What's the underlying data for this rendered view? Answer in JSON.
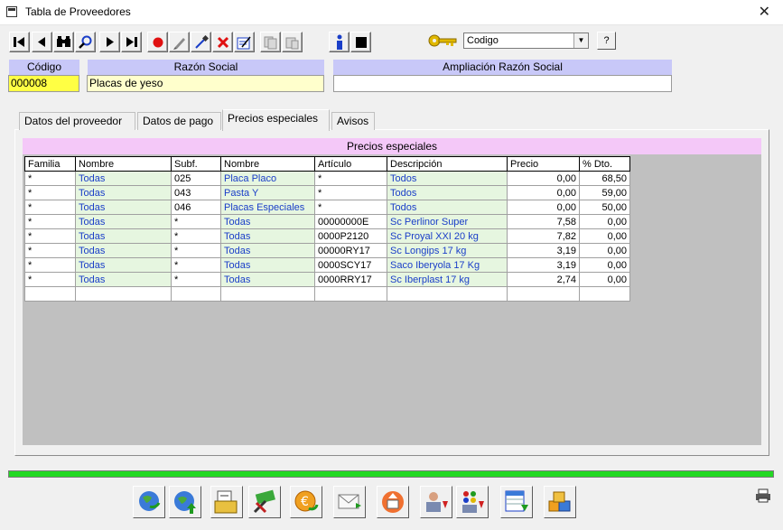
{
  "window": {
    "title": "Tabla de Proveedores",
    "close_glyph": "✕"
  },
  "toolbar": {
    "search_field": {
      "value": "Codigo"
    },
    "help_label": "?"
  },
  "header_fields": {
    "codigo": {
      "label": "Código",
      "value": "000008",
      "bg": "#ffff44"
    },
    "razon_social": {
      "label": "Razón Social",
      "value": "Placas de yeso",
      "bg": "#ffffcc"
    },
    "ampliacion": {
      "label": "Ampliación Razón Social",
      "value": ""
    }
  },
  "tabs": [
    {
      "label": "Datos del proveedor",
      "active": false
    },
    {
      "label": "Datos de pago",
      "active": false
    },
    {
      "label": "Precios especiales",
      "active": true
    },
    {
      "label": "Avisos",
      "active": false
    }
  ],
  "grid": {
    "title": "Precios especiales",
    "columns": [
      "Familia",
      "Nombre",
      "Subf.",
      "Nombre",
      "Artículo",
      "Descripción",
      "Precio",
      "% Dto."
    ],
    "rows": [
      [
        "*",
        "Todas",
        "025",
        "Placa Placo",
        "*",
        "Todos",
        "0,00",
        "68,50"
      ],
      [
        "*",
        "Todas",
        "043",
        "Pasta Y",
        "*",
        "Todos",
        "0,00",
        "59,00"
      ],
      [
        "*",
        "Todas",
        "046",
        "Placas Especiales",
        "*",
        "Todos",
        "0,00",
        "50,00"
      ],
      [
        "*",
        "Todas",
        "*",
        "Todas",
        "00000000E",
        "Sc Perlinor Super",
        "7,58",
        "0,00"
      ],
      [
        "*",
        "Todas",
        "*",
        "Todas",
        "0000P2120",
        "Sc Proyal XXI 20 kg",
        "7,82",
        "0,00"
      ],
      [
        "*",
        "Todas",
        "*",
        "Todas",
        "00000RY17",
        "Sc Longips 17 kg",
        "3,19",
        "0,00"
      ],
      [
        "*",
        "Todas",
        "*",
        "Todas",
        "0000SCY17",
        "Saco Iberyola 17 Kg",
        "3,19",
        "0,00"
      ],
      [
        "*",
        "Todas",
        "*",
        "Todas",
        "0000RRY17",
        "Sc Iberplast 17 kg",
        "2,74",
        "0,00"
      ],
      [
        "",
        "",
        "",
        "",
        "",
        "",
        "",
        ""
      ]
    ]
  },
  "colors": {
    "label_bg": "#c8c8f8",
    "grid_title_bg": "#f4c8f8",
    "green_cell": "#e6f6e0",
    "link_text": "#1a3ec8",
    "progress": "#22d822"
  },
  "progress": {
    "fraction": 1.0
  }
}
